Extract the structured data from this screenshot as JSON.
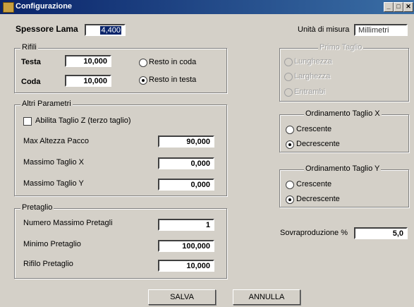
{
  "window": {
    "title": "Configurazione",
    "buttons": [
      "_",
      "□",
      "✕"
    ]
  },
  "spessore": {
    "label": "Spessore Lama",
    "value": "4,400"
  },
  "unita": {
    "label": "Unità di misura",
    "value": "Millimetri"
  },
  "rifili": {
    "title": "Rifili",
    "testa_label": "Testa",
    "testa_value": "10,000",
    "coda_label": "Coda",
    "coda_value": "10,000",
    "opt_coda": "Resto in coda",
    "opt_testa": "Resto in testa",
    "selected": "Resto in testa"
  },
  "primo_taglio": {
    "title": "Primo Taglio",
    "options": [
      "Lunghezza",
      "Larghezza",
      "Entrambi"
    ],
    "disabled": true
  },
  "altri": {
    "title": "Altri Parametri",
    "check_label": "Abilita Taglio Z (terzo taglio)",
    "checked": false,
    "max_altezza_label": "Max Altezza Pacco",
    "max_altezza_value": "90,000",
    "massimo_x_label": "Massimo Taglio X",
    "massimo_x_value": "0,000",
    "massimo_y_label": "Massimo Taglio Y",
    "massimo_y_value": "0,000"
  },
  "ord_x": {
    "title": "Ordinamento Taglio X",
    "opt1": "Crescente",
    "opt2": "Decrescente",
    "selected": "Decrescente"
  },
  "ord_y": {
    "title": "Ordinamento Taglio Y",
    "opt1": "Crescente",
    "opt2": "Decrescente",
    "selected": "Decrescente"
  },
  "pretaglio": {
    "title": "Pretaglio",
    "num_label": "Numero Massimo Pretagli",
    "num_value": "1",
    "min_label": "Minimo Pretaglio",
    "min_value": "100,000",
    "rif_label": "Rifilo Pretaglio",
    "rif_value": "10,000"
  },
  "sovra": {
    "label": "Sovraproduzione %",
    "value": "5,0"
  },
  "actions": {
    "save": "SALVA",
    "cancel": "ANNULLA"
  }
}
